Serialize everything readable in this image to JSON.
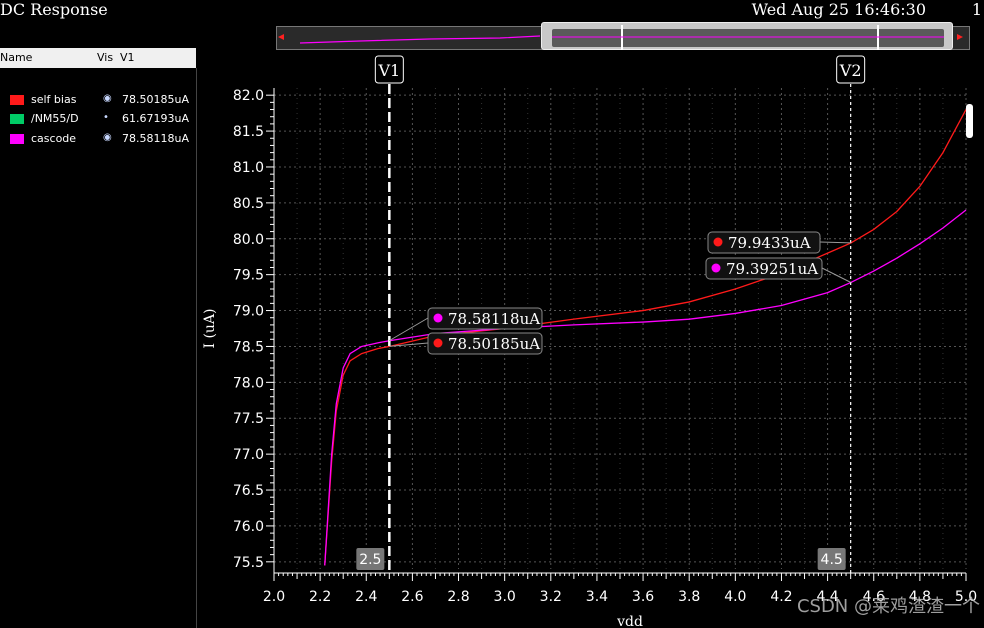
{
  "window": {
    "title": "DC Response",
    "datetime": "Wed Aug 25 16:46:30",
    "page_number": "1"
  },
  "legend": {
    "headers": {
      "name": "Name",
      "vis": "Vis",
      "v1": "V1"
    },
    "items": [
      {
        "name": "self bias",
        "color": "#ff1a1a",
        "vis_icon": "eye-icon",
        "value": "78.50185uA"
      },
      {
        "name": "/NM55/D",
        "color": "#00cc66",
        "vis_icon": "dot-icon",
        "value": "61.67193uA"
      },
      {
        "name": "cascode",
        "color": "#ff00ff",
        "vis_icon": "eye-icon",
        "value": "78.58118uA"
      }
    ]
  },
  "cursors": [
    {
      "name": "V1",
      "x": 2.5,
      "x_label": "2.5"
    },
    {
      "name": "V2",
      "x": 4.5,
      "x_label": "4.5"
    }
  ],
  "markers": [
    {
      "label": "78.58118uA",
      "color": "#ff00ff",
      "x": 2.5,
      "y": 78.58118
    },
    {
      "label": "78.50185uA",
      "color": "#ff1a1a",
      "x": 2.5,
      "y": 78.50185
    },
    {
      "label": "79.9433uA",
      "color": "#ff1a1a",
      "x": 4.5,
      "y": 79.9433
    },
    {
      "label": "79.39251uA",
      "color": "#ff00ff",
      "x": 4.5,
      "y": 79.39251
    }
  ],
  "watermark": "CSDN @莱鸡渣渣一个",
  "chart_data": {
    "type": "line",
    "xlabel": "vdd",
    "ylabel": "I (uA)",
    "xlim": [
      2.0,
      5.0
    ],
    "ylim": [
      75.4,
      82.1
    ],
    "x_ticks": [
      "2.0",
      "2.2",
      "2.4",
      "2.6",
      "2.8",
      "3.0",
      "3.2",
      "3.4",
      "3.6",
      "3.8",
      "4.0",
      "4.2",
      "4.4",
      "4.6",
      "4.8",
      "5.0"
    ],
    "y_ticks": [
      "75.5",
      "76.0",
      "76.5",
      "77.0",
      "77.5",
      "78.0",
      "78.5",
      "79.0",
      "79.5",
      "80.0",
      "80.5",
      "81.0",
      "81.5",
      "82.0"
    ],
    "grid": true,
    "series": [
      {
        "name": "self bias",
        "color": "#ff1a1a",
        "x": [
          2.22,
          2.25,
          2.27,
          2.3,
          2.33,
          2.38,
          2.45,
          2.5,
          2.7,
          3.0,
          3.3,
          3.6,
          3.8,
          4.0,
          4.2,
          4.4,
          4.5,
          4.6,
          4.7,
          4.8,
          4.9,
          5.0
        ],
        "y": [
          75.45,
          76.9,
          77.6,
          78.1,
          78.3,
          78.4,
          78.47,
          78.5,
          78.65,
          78.75,
          78.88,
          79.0,
          79.12,
          79.3,
          79.52,
          79.8,
          79.94,
          80.13,
          80.38,
          80.73,
          81.2,
          81.8
        ]
      },
      {
        "name": "cascode",
        "color": "#ff00ff",
        "x": [
          2.22,
          2.25,
          2.27,
          2.3,
          2.33,
          2.38,
          2.45,
          2.5,
          2.7,
          3.0,
          3.3,
          3.6,
          3.8,
          4.0,
          4.2,
          4.4,
          4.5,
          4.6,
          4.7,
          4.8,
          4.9,
          5.0
        ],
        "y": [
          75.45,
          77.0,
          77.7,
          78.2,
          78.4,
          78.5,
          78.55,
          78.58,
          78.68,
          78.75,
          78.8,
          78.84,
          78.88,
          78.96,
          79.07,
          79.25,
          79.39,
          79.55,
          79.73,
          79.93,
          80.15,
          80.4
        ]
      }
    ]
  }
}
